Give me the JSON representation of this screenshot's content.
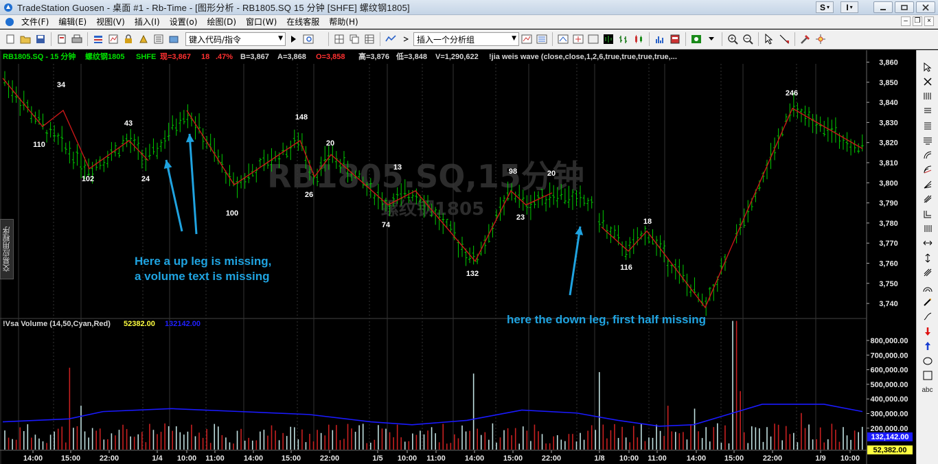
{
  "window": {
    "title": "TradeStation Guosen - 桌面 #1 - Rb-Time - [图形分析 - RB1805.SQ 15 分钟 [SHFE] 螺纹钢1805]",
    "sys_buttons": [
      "S",
      "I"
    ]
  },
  "menu": [
    "文件(F)",
    "编辑(E)",
    "视图(V)",
    "插入(I)",
    "设置(o)",
    "绘图(D)",
    "窗口(W)",
    "在线客服",
    "帮助(H)"
  ],
  "toolbar": {
    "symbol_input": "键入代码/指令",
    "analysis_group": "插入一个分析组"
  },
  "chart": {
    "header": {
      "symbol": "RB1805.SQ - 15 分钟",
      "name": "螺纹钢1805",
      "exchange": "SHFE",
      "last": "现=3,867",
      "change": "18",
      "pct": ".47%",
      "bid": "B=3,867",
      "ask": "A=3,868",
      "open": "O=3,858",
      "high": "高=3,876",
      "low": "低=3,848",
      "volume": "V=1,290,622",
      "study": "!jia weis wave (close,close,1,2,6,true,true,true,true,..."
    },
    "watermark_line1": "RB1805.SQ,15分钟",
    "watermark_line2": "螺纹钢1805",
    "side_tab": "交易应用程序",
    "price_axis": [
      "3,860",
      "3,850",
      "3,840",
      "3,830",
      "3,820",
      "3,810",
      "3,800",
      "3,790",
      "3,780",
      "3,770",
      "3,760",
      "3,750",
      "3,740"
    ],
    "wave_volumes": [
      "34",
      "110",
      "102",
      "43",
      "24",
      "100",
      "148",
      "26",
      "20",
      "13",
      "74",
      "132",
      "98",
      "23",
      "20",
      "116",
      "18",
      "246"
    ],
    "annotations": {
      "up_leg_line1": "Here a up leg is missing,",
      "up_leg_line2": "a volume text is missing",
      "down_leg": "here the down leg, first half missing"
    },
    "volume_header": {
      "label": "!Vsa Volume (14,50,Cyan,Red)",
      "value1": "52382.00",
      "value2": "132142.00"
    },
    "volume_axis": [
      "800,000.00",
      "700,000.00",
      "600,000.00",
      "500,000.00",
      "400,000.00",
      "300,000.00",
      "200,000.00"
    ],
    "volume_tag_blue": "132,142.00",
    "volume_tag_yellow": "52,382.00",
    "time_axis": [
      "14:00",
      "15:00",
      "22:00",
      "1/4",
      "10:00",
      "11:00",
      "14:00",
      "15:00",
      "22:00",
      "1/5",
      "10:00",
      "11:00",
      "14:00",
      "15:00",
      "22:00",
      "1/8",
      "10:00",
      "11:00",
      "14:00",
      "15:00",
      "22:00",
      "1/9",
      "10:00"
    ],
    "colors": {
      "bar": "#00cc00",
      "wave": "#c81818",
      "arrow": "#1fa3e0",
      "ma": "#1a1aff",
      "vol_up": "#c0e0e0",
      "vol_down": "#c82020"
    }
  },
  "drawing_tools": [
    "cursor",
    "text",
    "trend-line",
    "vertical-line",
    "horizontal-line",
    "fib-retrace",
    "fib-arc",
    "fib-fan",
    "gann",
    "andrews",
    "channel",
    "extend",
    "move",
    "resize",
    "parallel",
    "arc",
    "curve",
    "squiggle",
    "arrow-down",
    "arrow-up",
    "ellipse",
    "rectangle",
    "abc"
  ]
}
